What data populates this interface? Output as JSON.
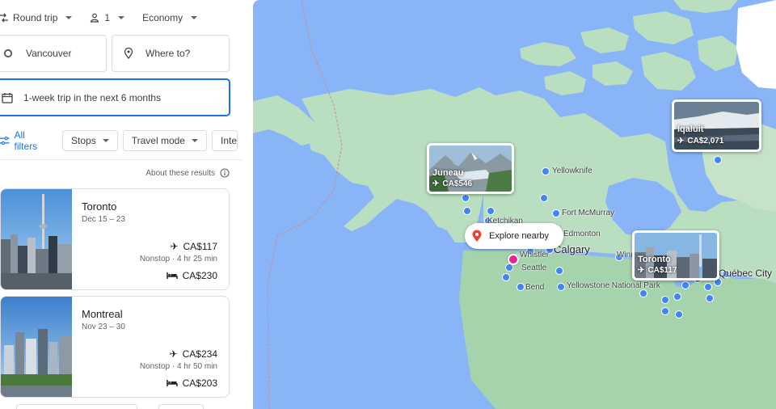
{
  "search": {
    "trip_type": "Round trip",
    "passengers": "1",
    "cabin_class": "Economy",
    "origin": "Vancouver",
    "destination_placeholder": "Where to?",
    "date_range": "1-week trip in the next 6 months"
  },
  "filters": {
    "all_filters_label": "All filters",
    "chips": [
      "Stops",
      "Travel mode",
      "Inte"
    ]
  },
  "results": {
    "about_label": "About these results",
    "cards": [
      {
        "city": "Toronto",
        "dates": "Dec 15 – 23",
        "flight_price": "CA$117",
        "stops": "Nonstop · 4 hr 25 min",
        "hotel_price": "CA$230"
      },
      {
        "city": "Montreal",
        "dates": "Nov 23 – 30",
        "flight_price": "CA$234",
        "stops": "Nonstop · 4 hr 50 min",
        "hotel_price": "CA$203"
      }
    ]
  },
  "map": {
    "explore_label": "Explore nearby",
    "labels": {
      "yellowknife": "Yellowknife",
      "ketchikan": "Ketchikan",
      "fort_mcmurray": "Fort McMurray",
      "edmonton": "Edmonton",
      "whistler": "Whistler",
      "calgary": "Calgary",
      "winnipeg": "Winn",
      "seattle": "Seattle",
      "bend": "Bend",
      "yellowstone": "Yellowstone National Park",
      "quebec": "Québec City"
    },
    "photo_pins": [
      {
        "name": "Iqaluit",
        "price": "CA$2,071"
      },
      {
        "name": "Juneau",
        "price": "CA$546"
      },
      {
        "name": "Toronto",
        "price": "CA$117"
      }
    ]
  },
  "colors": {
    "accent": "#1a73e8",
    "water": "#8ab4f8",
    "land": "#a8dab5",
    "pin": "#4285f4",
    "origin_pin": "#e52592"
  }
}
